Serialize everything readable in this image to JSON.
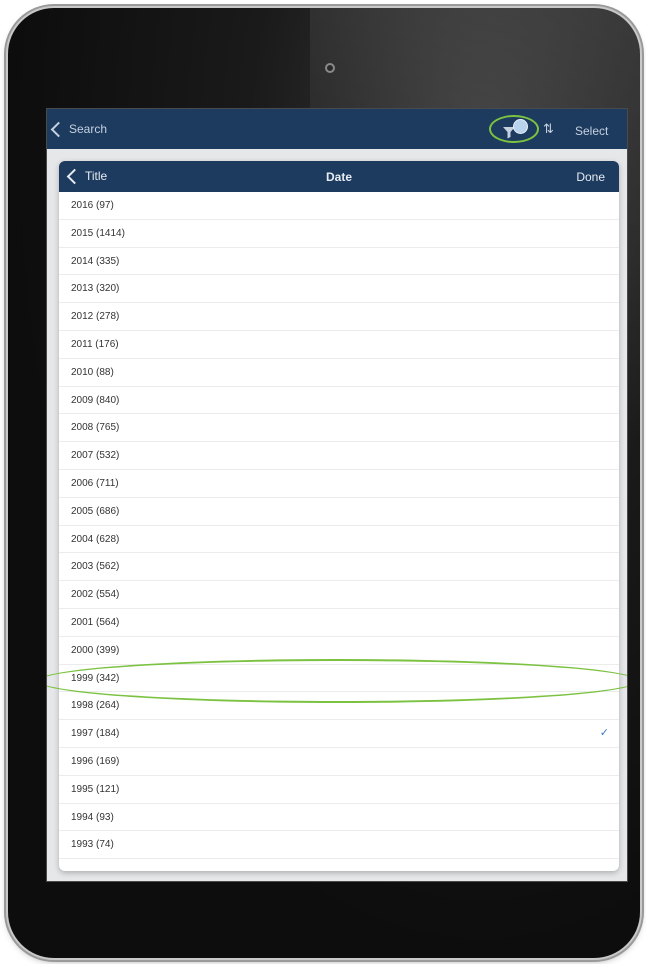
{
  "topbar": {
    "back_label": "Search",
    "select_label": "Select",
    "filter_icon": "filter-icon",
    "sort_icon": "sort-icon"
  },
  "popover": {
    "back_label": "Title",
    "title": "Date",
    "done_label": "Done"
  },
  "years": [
    {
      "label": "2016 (97)",
      "selected": false
    },
    {
      "label": "2015 (1414)",
      "selected": false
    },
    {
      "label": "2014 (335)",
      "selected": false
    },
    {
      "label": "2013 (320)",
      "selected": false
    },
    {
      "label": "2012 (278)",
      "selected": false
    },
    {
      "label": "2011 (176)",
      "selected": false
    },
    {
      "label": "2010 (88)",
      "selected": false
    },
    {
      "label": "2009 (840)",
      "selected": false
    },
    {
      "label": "2008 (765)",
      "selected": false
    },
    {
      "label": "2007 (532)",
      "selected": false
    },
    {
      "label": "2006 (711)",
      "selected": false
    },
    {
      "label": "2005 (686)",
      "selected": false
    },
    {
      "label": "2004 (628)",
      "selected": false
    },
    {
      "label": "2003 (562)",
      "selected": false
    },
    {
      "label": "2002 (554)",
      "selected": false
    },
    {
      "label": "2001 (564)",
      "selected": false
    },
    {
      "label": "2000 (399)",
      "selected": false
    },
    {
      "label": "1999 (342)",
      "selected": false
    },
    {
      "label": "1998 (264)",
      "selected": false
    },
    {
      "label": "1997 (184)",
      "selected": true
    },
    {
      "label": "1996 (169)",
      "selected": false
    },
    {
      "label": "1995 (121)",
      "selected": false
    },
    {
      "label": "1994 (93)",
      "selected": false
    },
    {
      "label": "1993 (74)",
      "selected": false
    }
  ],
  "checkmark": "✓",
  "colors": {
    "navbar": "#1d3a5f",
    "highlight": "#7cc241",
    "check": "#3b78c4"
  }
}
